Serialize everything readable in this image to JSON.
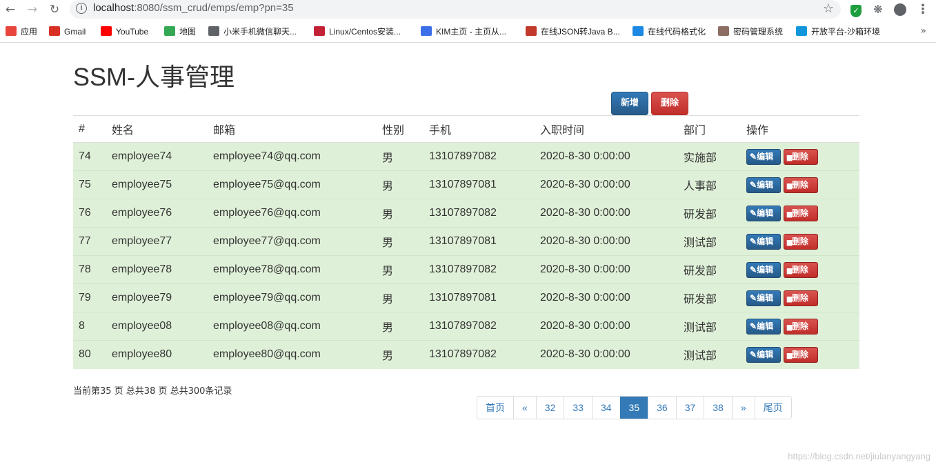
{
  "browser": {
    "url_host": "localhost",
    "url_path": ":8080/ssm_crud/emps/emp?pn=35",
    "back_icon": "arrow-left-icon",
    "forward_icon": "arrow-right-icon",
    "reload_icon": "reload-icon"
  },
  "bookmarks": [
    {
      "label": "应用",
      "icon": "apps-grid-icon",
      "color": "#e8453c"
    },
    {
      "label": "Gmail",
      "icon": "gmail-icon",
      "color": "#d93025"
    },
    {
      "label": "YouTube",
      "icon": "youtube-icon",
      "color": "#ff0000"
    },
    {
      "label": "地图",
      "icon": "maps-icon",
      "color": "#34a853"
    },
    {
      "label": "小米手机微信聊天...",
      "icon": "globe-icon",
      "color": "#5f6368"
    },
    {
      "label": "Linux/Centos安装...",
      "icon": "csdn-icon",
      "color": "#c32136"
    },
    {
      "label": "KIM主页 - 主页从...",
      "icon": "kim-icon",
      "color": "#3b6ee8"
    },
    {
      "label": "在线JSON转Java B...",
      "icon": "bejson-icon",
      "color": "#c0392b"
    },
    {
      "label": "在线代码格式化",
      "icon": "code-format-icon",
      "color": "#1e88e5"
    },
    {
      "label": "密码管理系统",
      "icon": "image-icon",
      "color": "#8d6e63"
    },
    {
      "label": "开放平台-沙箱环境",
      "icon": "alipay-icon",
      "color": "#1296db"
    }
  ],
  "page": {
    "title": "SSM-人事管理",
    "add_button": "新增",
    "delete_button": "删除"
  },
  "table": {
    "headers": [
      "#",
      "姓名",
      "邮箱",
      "性别",
      "手机",
      "入职时间",
      "部门",
      "操作"
    ],
    "edit_label": "编辑",
    "delete_label": "删除",
    "rows": [
      {
        "id": "74",
        "name": "employee74",
        "email": "employee74@qq.com",
        "gender": "男",
        "phone": "13107897082",
        "hired": "2020-8-30 0:00:00",
        "dept": "实施部"
      },
      {
        "id": "75",
        "name": "employee75",
        "email": "employee75@qq.com",
        "gender": "男",
        "phone": "13107897081",
        "hired": "2020-8-30 0:00:00",
        "dept": "人事部"
      },
      {
        "id": "76",
        "name": "employee76",
        "email": "employee76@qq.com",
        "gender": "男",
        "phone": "13107897082",
        "hired": "2020-8-30 0:00:00",
        "dept": "研发部"
      },
      {
        "id": "77",
        "name": "employee77",
        "email": "employee77@qq.com",
        "gender": "男",
        "phone": "13107897081",
        "hired": "2020-8-30 0:00:00",
        "dept": "测试部"
      },
      {
        "id": "78",
        "name": "employee78",
        "email": "employee78@qq.com",
        "gender": "男",
        "phone": "13107897082",
        "hired": "2020-8-30 0:00:00",
        "dept": "研发部"
      },
      {
        "id": "79",
        "name": "employee79",
        "email": "employee79@qq.com",
        "gender": "男",
        "phone": "13107897081",
        "hired": "2020-8-30 0:00:00",
        "dept": "研发部"
      },
      {
        "id": "8",
        "name": "employee08",
        "email": "employee08@qq.com",
        "gender": "男",
        "phone": "13107897082",
        "hired": "2020-8-30 0:00:00",
        "dept": "测试部"
      },
      {
        "id": "80",
        "name": "employee80",
        "email": "employee80@qq.com",
        "gender": "男",
        "phone": "13107897082",
        "hired": "2020-8-30 0:00:00",
        "dept": "测试部"
      }
    ]
  },
  "pageinfo": "当前第35 页 总共38 页 总共300条记录",
  "pagination": {
    "first": "首页",
    "prev": "«",
    "pages": [
      "32",
      "33",
      "34",
      "35",
      "36",
      "37",
      "38"
    ],
    "active": "35",
    "next": "»",
    "last": "尾页"
  },
  "watermark": "https://blog.csdn.net/jiulanyangyang",
  "colors": {
    "primary": "#337ab7",
    "danger": "#d9534f",
    "row_success": "#dff0d8"
  }
}
